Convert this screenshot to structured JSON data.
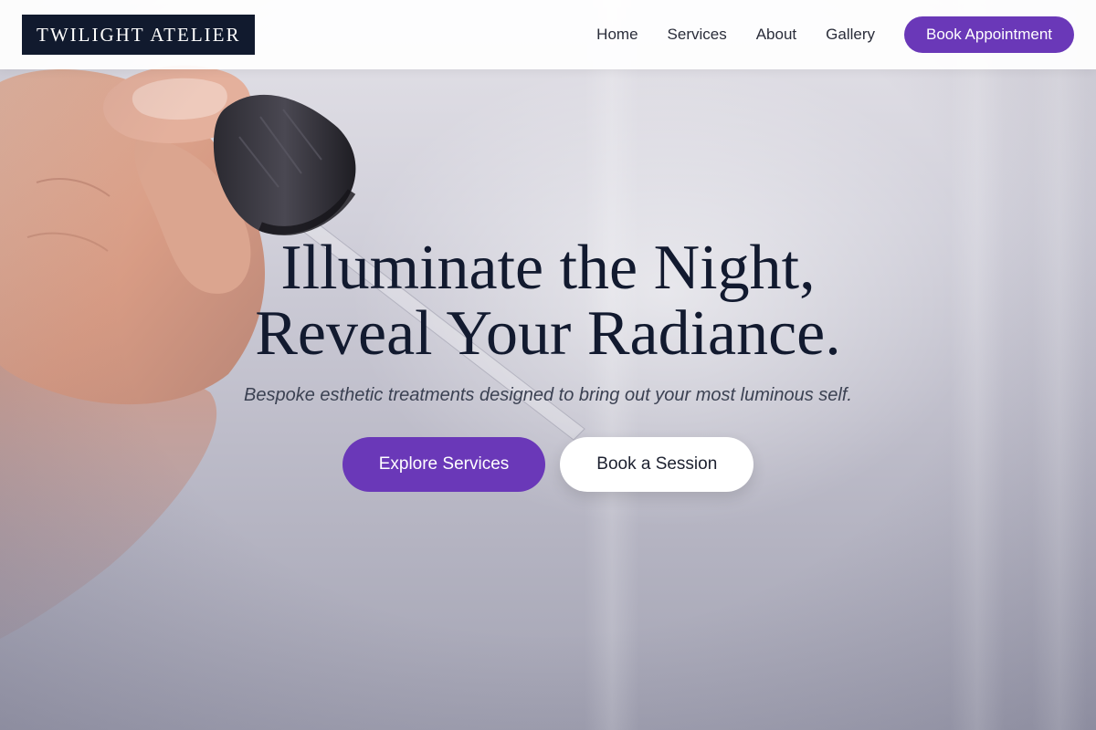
{
  "header": {
    "logo": "TWILIGHT ATELIER",
    "nav": [
      {
        "label": "Home"
      },
      {
        "label": "Services"
      },
      {
        "label": "About"
      },
      {
        "label": "Gallery"
      }
    ],
    "cta": "Book Appointment"
  },
  "hero": {
    "title_line_1": "Illuminate the Night,",
    "title_line_2": "Reveal Your Radiance.",
    "subtitle": "Bespoke esthetic treatments designed to bring out your most luminous self.",
    "primary_button": "Explore Services",
    "secondary_button": "Book a Session",
    "background_image": "hand-holding-serum-dropper"
  },
  "colors": {
    "accent": "#6a38b8",
    "logo_background": "#111a2e",
    "heading": "#121a2f"
  }
}
